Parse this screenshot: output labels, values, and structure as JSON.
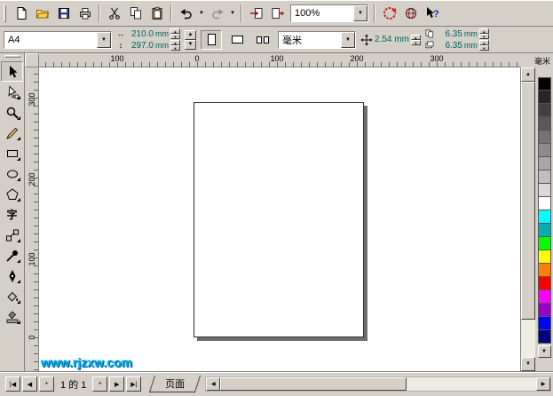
{
  "colors": {
    "chrome": "#d4d0c8",
    "canvas": "#ffffff",
    "field_text": "#006060",
    "watermark": "#00a8e8"
  },
  "glyphs": {
    "dropdown": "▼",
    "spin_up": "▲",
    "spin_down": "▼",
    "scroll_up": "▲",
    "scroll_down": "▼",
    "scroll_left": "◀",
    "scroll_right": "▶",
    "palette_more": "▼",
    "nav_first": "|◀",
    "nav_prev": "◀",
    "nav_next": "▶",
    "nav_last": "▶|",
    "add_page": "+",
    "width_icon": "↔",
    "height_icon": "↕"
  },
  "toolbar": {
    "zoom_value": "100%"
  },
  "property_bar": {
    "paper_type": "A4",
    "paper_width": "210.0",
    "paper_height": "297.0",
    "size_unit": "mm",
    "units": "毫米",
    "nudge_offset": "2.54 mm",
    "duplicate_x": "6.35",
    "duplicate_y": "6.35",
    "duplicate_unit": "mm"
  },
  "toolbox": {
    "text_tool_glyph": "字"
  },
  "rulers": {
    "unit_label": "毫米",
    "h_labels": [
      "100",
      "0",
      "100",
      "200",
      "300"
    ],
    "v_labels": [
      "300",
      "200",
      "100",
      "0"
    ]
  },
  "statusbar": {
    "page_indicator": "1 的 1",
    "page_tab": "页面"
  },
  "watermark": "www.rjzxw.com",
  "palette": {
    "colors": [
      "#000000",
      "#262626",
      "#404040",
      "#595959",
      "#737373",
      "#8c8c8c",
      "#a6a6a6",
      "#bfbfbf",
      "#d9d9d9",
      "#ffffff",
      "#00ffff",
      "#00b0b0",
      "#00ff00",
      "#ffff00",
      "#ff8000",
      "#ff0000",
      "#ff00ff",
      "#9900cc",
      "#0000ff",
      "#000080"
    ]
  }
}
